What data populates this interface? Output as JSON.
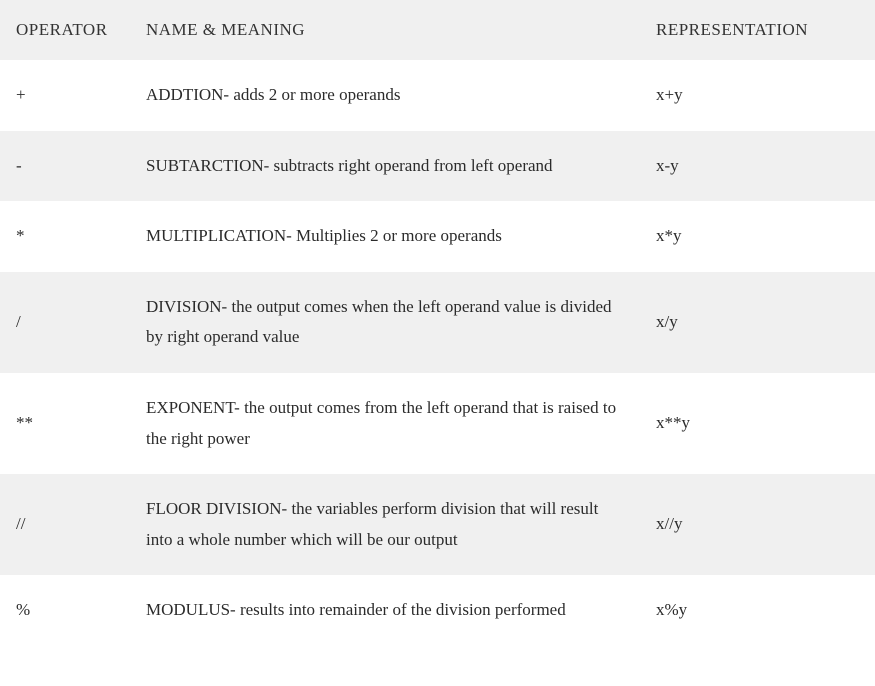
{
  "table": {
    "headers": {
      "operator": "OPERATOR",
      "name": "NAME & MEANING",
      "representation": "REPRESENTATION"
    },
    "rows": [
      {
        "operator": "+",
        "name": "ADDTION- adds 2 or more operands",
        "representation": "x+y"
      },
      {
        "operator": "-",
        "name": "SUBTARCTION- subtracts right operand from left operand",
        "representation": "x-y"
      },
      {
        "operator": "*",
        "name": "MULTIPLICATION- Multiplies 2 or more operands",
        "representation": "x*y"
      },
      {
        "operator": "/",
        "name": "DIVISION- the output comes when the left operand value is divided by right operand value",
        "representation": "x/y"
      },
      {
        "operator": "**",
        "name": "EXPONENT- the output comes from the left operand that is raised to the right power",
        "representation": "x**y"
      },
      {
        "operator": "//",
        "name": "FLOOR DIVISION- the variables perform division that will result into a whole number which will be our output",
        "representation": "x//y"
      },
      {
        "operator": "%",
        "name": "MODULUS- results into remainder of the division performed",
        "representation": "x%y"
      }
    ]
  }
}
